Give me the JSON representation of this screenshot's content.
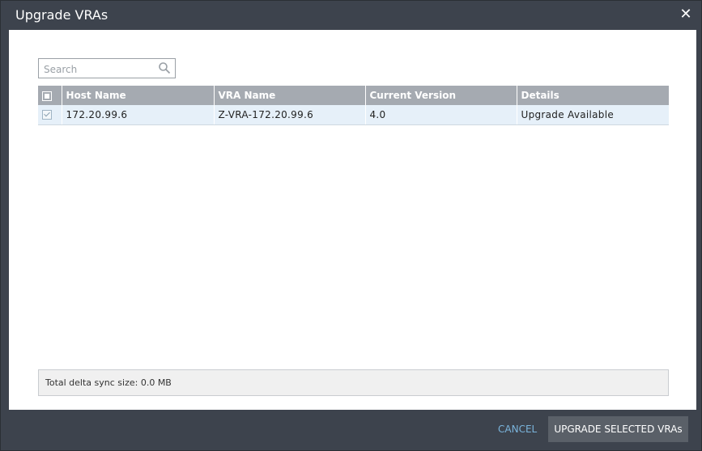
{
  "dialog": {
    "title": "Upgrade VRAs",
    "close_icon": "close-icon"
  },
  "search": {
    "placeholder": "Search",
    "value": "",
    "icon": "search-icon"
  },
  "table": {
    "columns": [
      "Host Name",
      "VRA Name",
      "Current Version",
      "Details"
    ],
    "rows": [
      {
        "checked": true,
        "host_name": "172.20.99.6",
        "vra_name": "Z-VRA-172.20.99.6",
        "current_version": "4.0",
        "details": "Upgrade Available"
      }
    ]
  },
  "summary": {
    "text": "Total delta sync size: 0.0 MB"
  },
  "footer": {
    "cancel_label": "CANCEL",
    "upgrade_label": "UPGRADE SELECTED VRAs"
  },
  "colors": {
    "chrome": "#3d434d",
    "header": "#a5aab1",
    "row": "#e6f0f9",
    "cancel": "#7ab4dc",
    "primary_button": "#5a6068"
  }
}
